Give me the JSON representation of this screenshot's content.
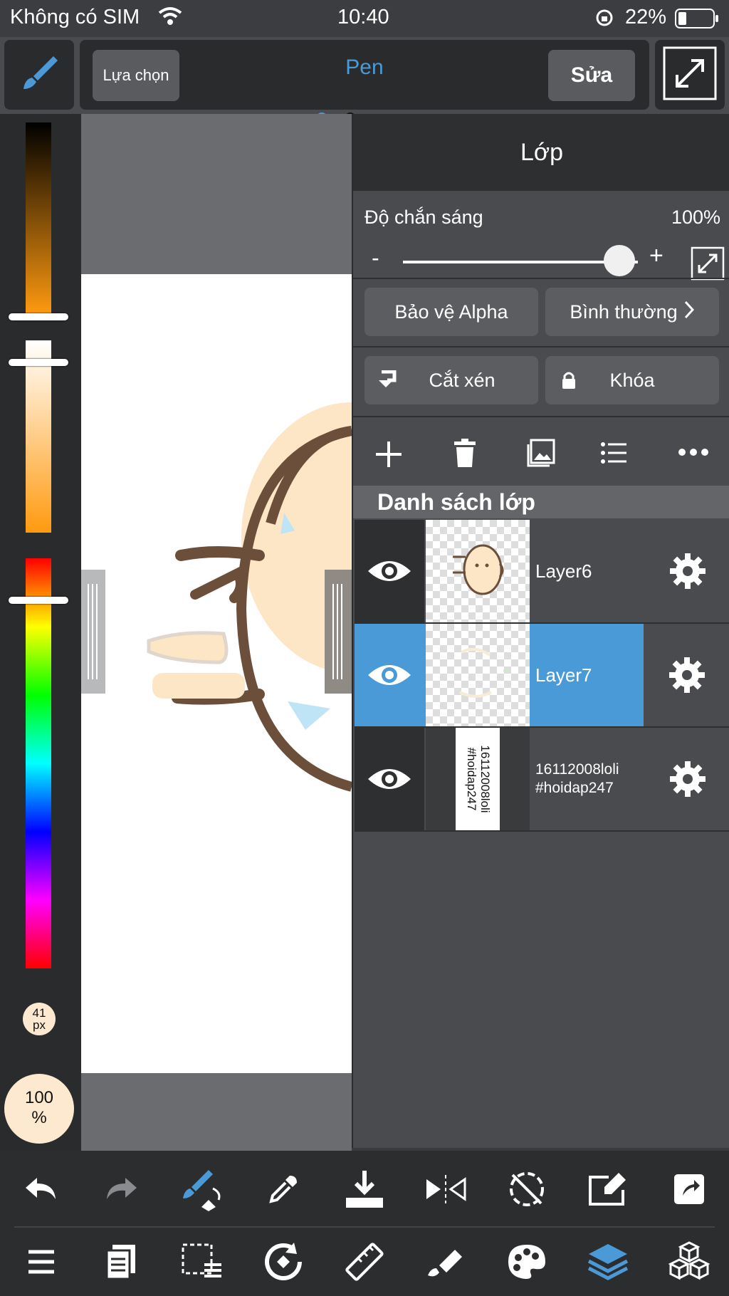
{
  "status": {
    "carrier": "Không có SIM",
    "time": "10:40",
    "battery": "22%"
  },
  "toolbar": {
    "select_label": "Lựa chọn",
    "tool_name": "Pen",
    "edit_label": "Sửa",
    "accent": "#4a9ad8"
  },
  "left_panel": {
    "brush_size": "41\npx",
    "opacity": "100\n%"
  },
  "layer_panel": {
    "title": "Lớp",
    "opacity_label": "Độ chắn sáng",
    "opacity_value": "100%",
    "opacity_level": 1.0,
    "minus": "-",
    "plus": "+",
    "alpha_protect": "Bảo vệ Alpha",
    "blend_mode": "Bình thường",
    "clipping": "Cắt xén",
    "lock": "Khóa",
    "list_title": "Danh sách lớp",
    "layers": [
      {
        "name": "Layer6",
        "selected": false
      },
      {
        "name": "Layer7",
        "selected": true
      },
      {
        "name": "16112008loli\n#hoidap247",
        "selected": false,
        "thumb_text": "16112008loli\n#hoidap247"
      }
    ]
  }
}
